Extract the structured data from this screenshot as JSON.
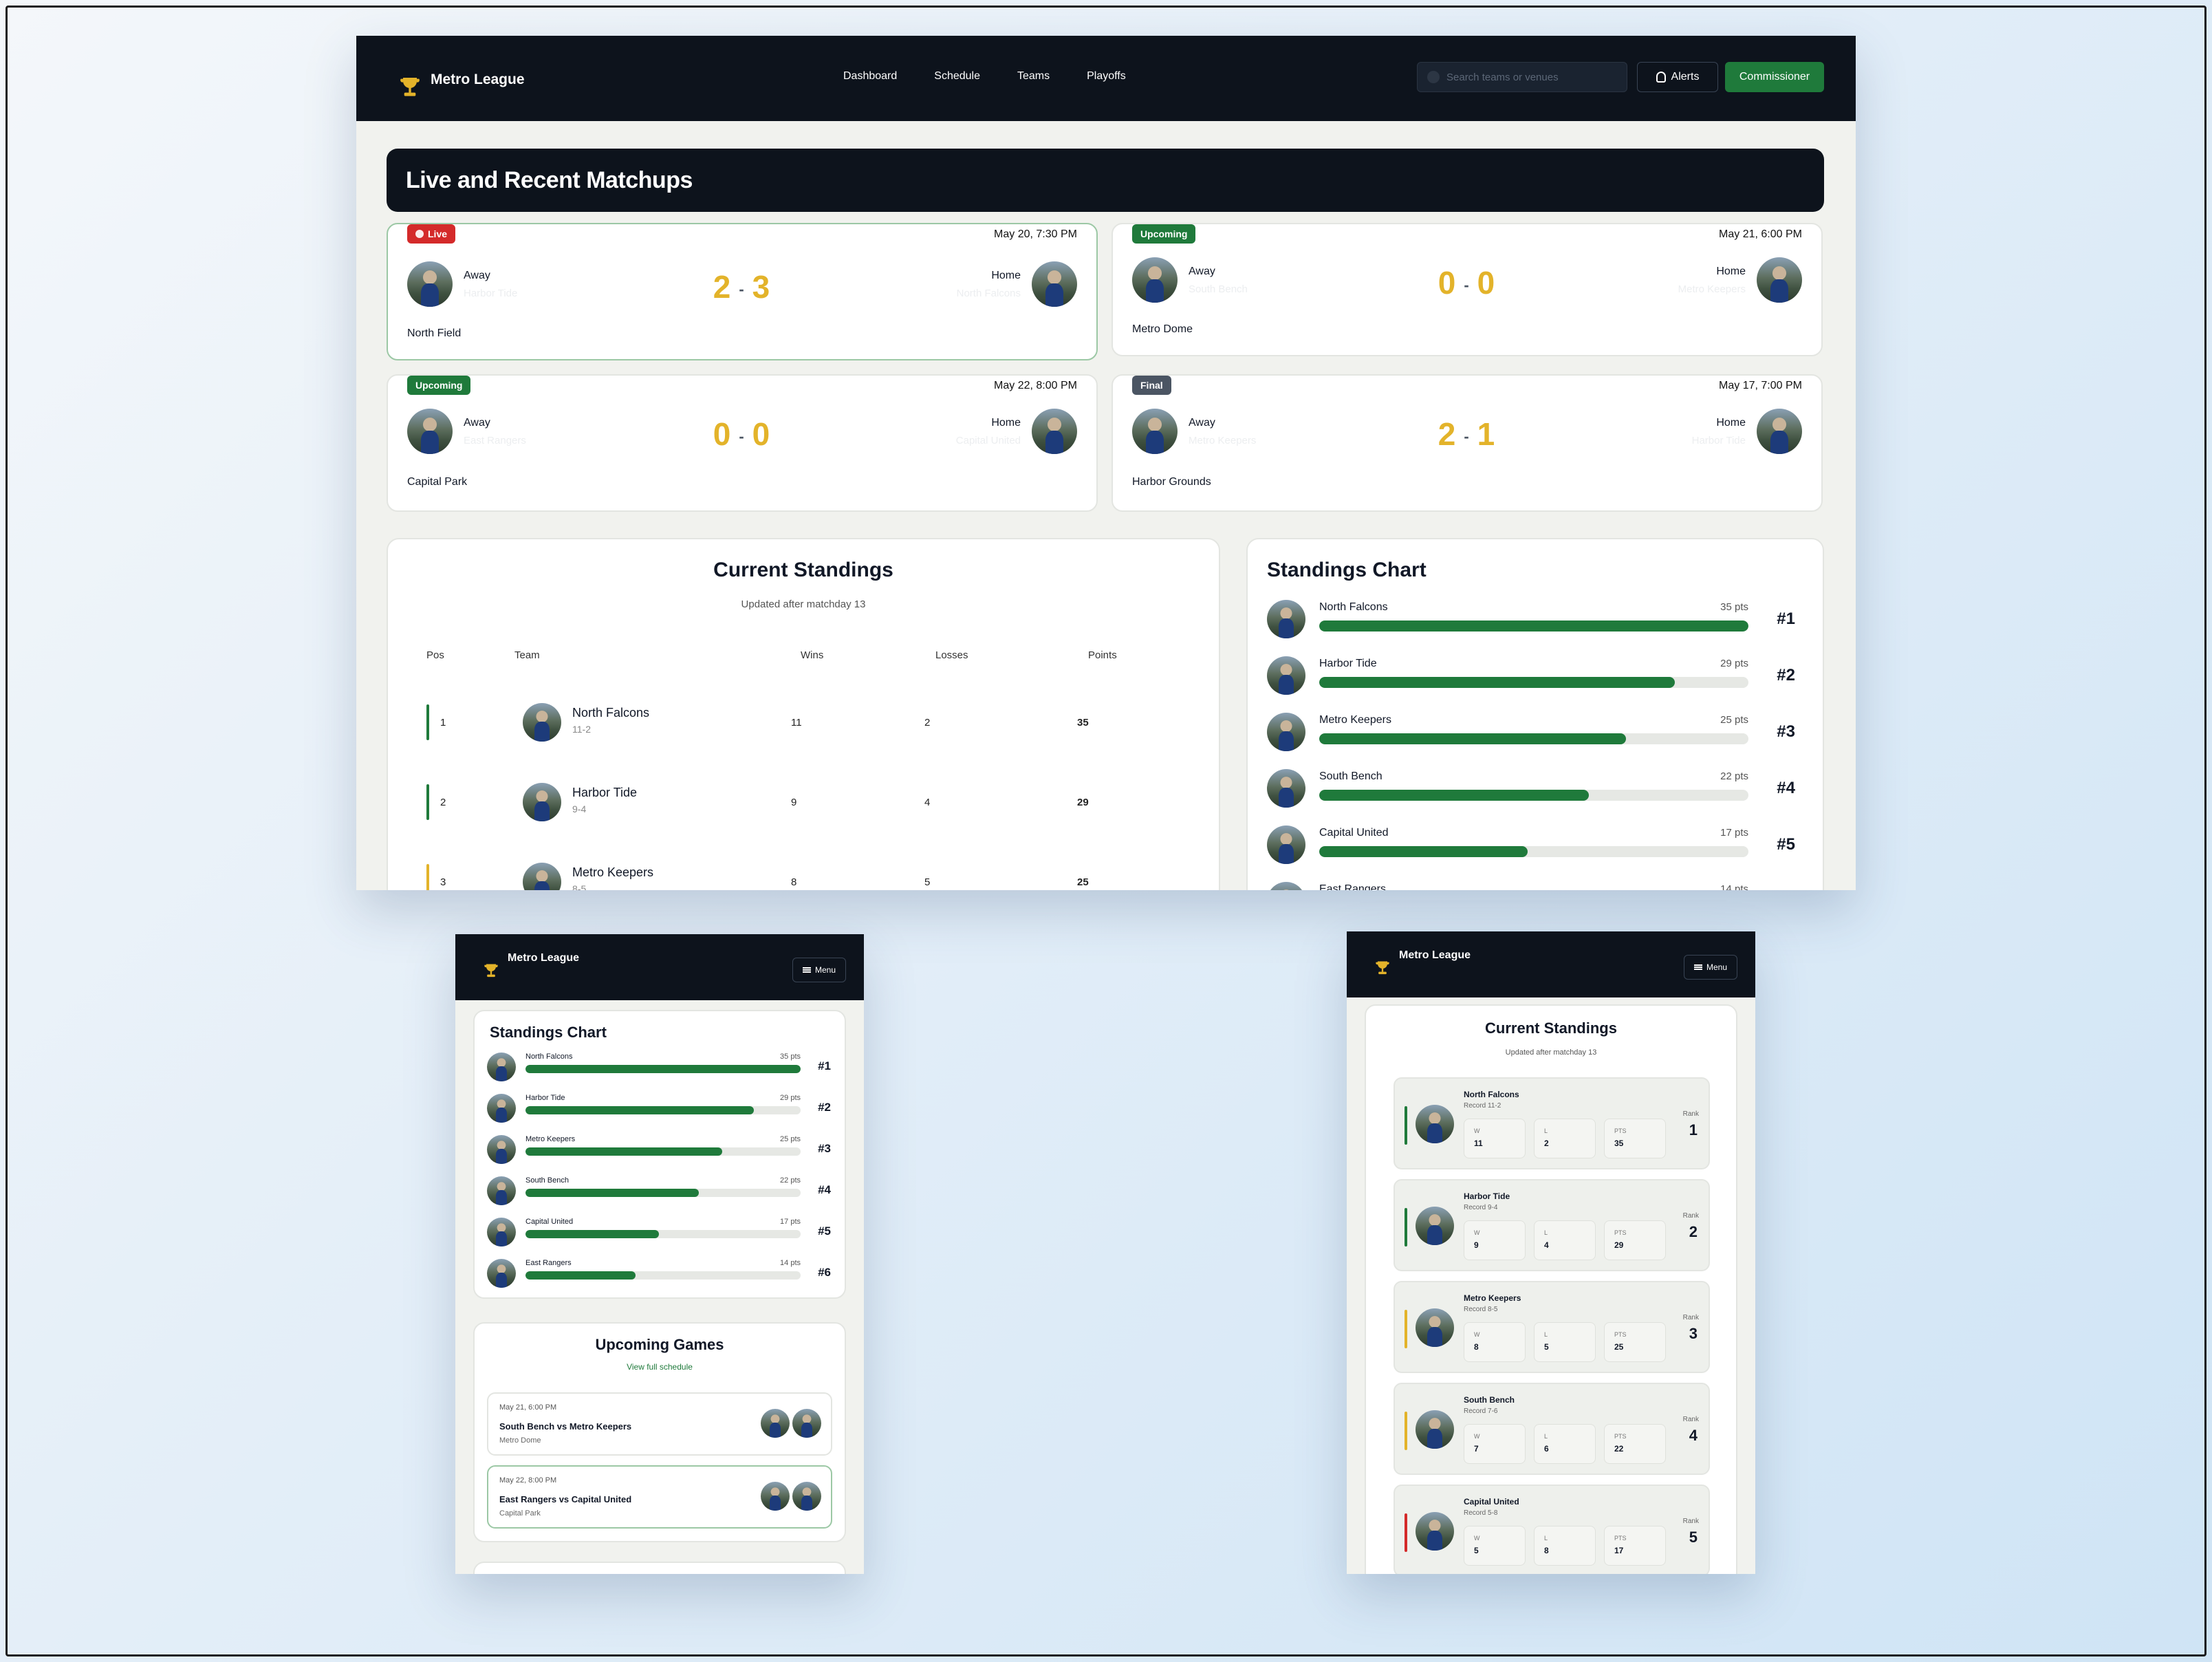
{
  "brand": "Metro League",
  "nav": {
    "links": [
      "Dashboard",
      "Schedule",
      "Teams",
      "Playoffs"
    ],
    "search_placeholder": "Search teams or venues",
    "alerts": "Alerts",
    "commissioner": "Commissioner"
  },
  "matchups_title": "Live and Recent Matchups",
  "matches": [
    {
      "status": "Live",
      "when": "May 20, 7:30 PM",
      "away_label": "Away",
      "away_team": "Harbor Tide",
      "home_label": "Home",
      "home_team": "North Falcons",
      "away_score": "2",
      "home_score": "3",
      "sep": "-",
      "venue": "North Field"
    },
    {
      "status": "Upcoming",
      "when": "May 21, 6:00 PM",
      "away_label": "Away",
      "away_team": "South Bench",
      "home_label": "Home",
      "home_team": "Metro Keepers",
      "away_score": "0",
      "home_score": "0",
      "sep": "-",
      "venue": "Metro Dome"
    },
    {
      "status": "Upcoming",
      "when": "May 22, 8:00 PM",
      "away_label": "Away",
      "away_team": "East Rangers",
      "home_label": "Home",
      "home_team": "Capital United",
      "away_score": "0",
      "home_score": "0",
      "sep": "-",
      "venue": "Capital Park"
    },
    {
      "status": "Final",
      "when": "May 17, 7:00 PM",
      "away_label": "Away",
      "away_team": "Metro Keepers",
      "home_label": "Home",
      "home_team": "Harbor Tide",
      "away_score": "2",
      "home_score": "1",
      "sep": "-",
      "venue": "Harbor Grounds"
    }
  ],
  "standings": {
    "title": "Current Standings",
    "subtitle": "Updated after matchday 13",
    "headers": {
      "pos": "Pos",
      "team": "Team",
      "wins": "Wins",
      "losses": "Losses",
      "points": "Points"
    },
    "rows": [
      {
        "pos": "1",
        "team": "North Falcons",
        "record": "11-2",
        "wins": "11",
        "losses": "2",
        "points": "35",
        "accent": "#1f7a3b"
      },
      {
        "pos": "2",
        "team": "Harbor Tide",
        "record": "9-4",
        "wins": "9",
        "losses": "4",
        "points": "29",
        "accent": "#1f7a3b"
      },
      {
        "pos": "3",
        "team": "Metro Keepers",
        "record": "8-5",
        "wins": "8",
        "losses": "5",
        "points": "25",
        "accent": "#e3b32a"
      }
    ]
  },
  "chart": {
    "title": "Standings Chart",
    "rows": [
      {
        "team": "North Falcons",
        "pts_label": "35 pts",
        "rank": "#1",
        "fill": 1.0
      },
      {
        "team": "Harbor Tide",
        "pts_label": "29 pts",
        "rank": "#2",
        "fill": 0.829
      },
      {
        "team": "Metro Keepers",
        "pts_label": "25 pts",
        "rank": "#3",
        "fill": 0.714
      },
      {
        "team": "South Bench",
        "pts_label": "22 pts",
        "rank": "#4",
        "fill": 0.629
      },
      {
        "team": "Capital United",
        "pts_label": "17 pts",
        "rank": "#5",
        "fill": 0.486
      },
      {
        "team": "East Rangers",
        "pts_label": "14 pts",
        "rank": "#6",
        "fill": 0.4
      }
    ]
  },
  "mobile": {
    "menu": "Menu",
    "upcoming_title": "Upcoming Games",
    "view_schedule": "View full schedule",
    "games": [
      {
        "when": "May 21, 6:00 PM",
        "matchup": "South Bench vs Metro Keepers",
        "venue": "Metro Dome"
      },
      {
        "when": "May 22, 8:00 PM",
        "matchup": "East Rangers vs Capital United",
        "venue": "Capital Park"
      }
    ],
    "cards": [
      {
        "team": "North Falcons",
        "record": "Record 11-2",
        "w": "11",
        "l": "2",
        "pts": "35",
        "rank": "1",
        "accent": "#1f7a3b"
      },
      {
        "team": "Harbor Tide",
        "record": "Record 9-4",
        "w": "9",
        "l": "4",
        "pts": "29",
        "rank": "2",
        "accent": "#1f7a3b"
      },
      {
        "team": "Metro Keepers",
        "record": "Record 8-5",
        "w": "8",
        "l": "5",
        "pts": "25",
        "rank": "3",
        "accent": "#e3b32a"
      },
      {
        "team": "South Bench",
        "record": "Record 7-6",
        "w": "7",
        "l": "6",
        "pts": "22",
        "rank": "4",
        "accent": "#e3b32a"
      },
      {
        "team": "Capital United",
        "record": "Record 5-8",
        "w": "5",
        "l": "8",
        "pts": "17",
        "rank": "5",
        "accent": "#d42a2a"
      }
    ],
    "labels": {
      "w": "W",
      "l": "L",
      "pts": "PTS",
      "rank": "Rank"
    }
  },
  "colors": {
    "accent_green": "#1f7a3b",
    "score_gold": "#e3b32a",
    "live_red": "#d42a2a",
    "nav_dark": "#0d131c"
  }
}
